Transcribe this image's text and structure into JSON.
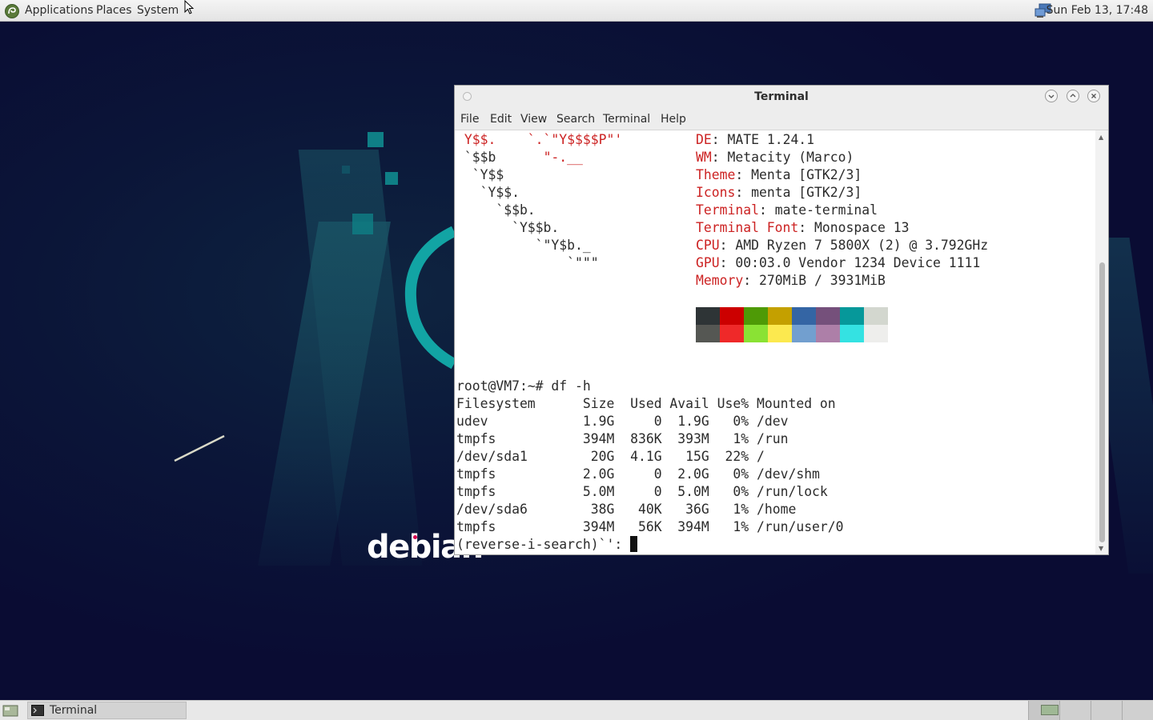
{
  "top_panel": {
    "menus": [
      "Applications",
      "Places",
      "System"
    ],
    "clock": "Sun Feb 13, 17:48"
  },
  "desktop": {
    "logo_text": "debian"
  },
  "terminal_window": {
    "title": "Terminal",
    "menu": [
      "File",
      "Edit",
      "View",
      "Search",
      "Terminal",
      "Help"
    ],
    "ascii_art": [
      " Y$$.    `.`\"Y$$$$P\"'",
      " `$$b      \"-.__",
      "  `Y$$",
      "   `Y$$.",
      "     `$$b.",
      "       `Y$$b.",
      "          `\"Y$b._",
      "              `\"\"\""
    ],
    "sysinfo": [
      {
        "label": "DE",
        "value": "MATE 1.24.1"
      },
      {
        "label": "WM",
        "value": "Metacity (Marco)"
      },
      {
        "label": "Theme",
        "value": "Menta [GTK2/3]"
      },
      {
        "label": "Icons",
        "value": "menta [GTK2/3]"
      },
      {
        "label": "Terminal",
        "value": "mate-terminal"
      },
      {
        "label": "Terminal Font",
        "value": "Monospace 13"
      },
      {
        "label": "CPU",
        "value": "AMD Ryzen 7 5800X (2) @ 3.792GHz"
      },
      {
        "label": "GPU",
        "value": "00:03.0 Vendor 1234 Device 1111"
      },
      {
        "label": "Memory",
        "value": "270MiB / 3931MiB"
      }
    ],
    "palette_top": [
      "#2e3436",
      "#cc0000",
      "#4e9a06",
      "#c4a000",
      "#3465a4",
      "#75507b",
      "#06989a",
      "#d3d7cf"
    ],
    "palette_bottom": [
      "#555753",
      "#ef2929",
      "#8ae234",
      "#fce94f",
      "#729fcf",
      "#ad7fa8",
      "#34e2e2",
      "#eeeeec"
    ],
    "prompt": "root@VM7:~# df -h",
    "df_output": [
      "Filesystem      Size  Used Avail Use% Mounted on",
      "udev            1.9G     0  1.9G   0% /dev",
      "tmpfs           394M  836K  393M   1% /run",
      "/dev/sda1        20G  4.1G   15G  22% /",
      "tmpfs           2.0G     0  2.0G   0% /dev/shm",
      "tmpfs           5.0M     0  5.0M   0% /run/lock",
      "/dev/sda6        38G   40K   36G   1% /home",
      "tmpfs           394M   56K  394M   1% /run/user/0"
    ],
    "search_line": "(reverse-i-search)`': "
  },
  "bottom_panel": {
    "task": "Terminal"
  }
}
